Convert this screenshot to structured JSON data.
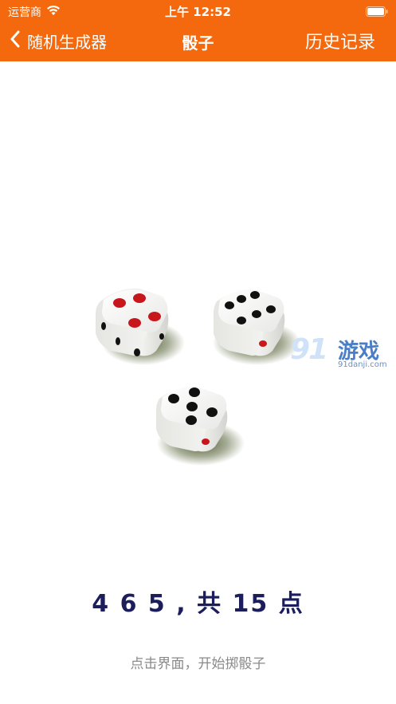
{
  "status_bar": {
    "carrier": "运营商",
    "time": "上午 12:52"
  },
  "nav": {
    "back_label": "随机生成器",
    "title": "骰子",
    "history_label": "历史记录"
  },
  "dice": [
    {
      "value": 4,
      "pip_color": "#c8161d"
    },
    {
      "value": 6,
      "pip_color": "#111111"
    },
    {
      "value": 5,
      "pip_color": "#111111"
    }
  ],
  "watermark": {
    "logo_text": "91",
    "name": "游戏",
    "url": "91danji.com"
  },
  "result_text": "4 6 5 , 共 15 点",
  "hint_text": "点击界面，开始掷骰子",
  "colors": {
    "header": "#f5690e",
    "result": "#1c1e5c",
    "hint": "#8a8a8a"
  }
}
